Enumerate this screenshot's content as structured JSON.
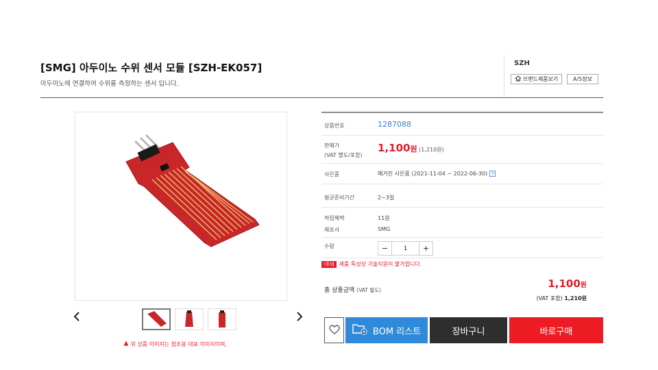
{
  "product": {
    "title": "[SMG] 아두이노 수위 센서 모듈 [SZH-EK057]",
    "subtitle": "아두이노에 연결하여 수위를 측정하는 센서 입니다."
  },
  "brand": {
    "name": "SZH",
    "brand_products_label": "브랜드제품보기",
    "as_info_label": "A/S정보"
  },
  "gallery": {
    "note": "위 상품 이미지는 참조용 대표 이미지이며,",
    "prev_icon": "chevron-left-icon",
    "next_icon": "chevron-right-icon"
  },
  "info": {
    "code_label": "상품번호",
    "code_value": "1287088",
    "price_label_1": "판매가",
    "price_label_2": "(VAT 별도/포함)",
    "price_value": "1,100",
    "price_unit": "원",
    "price_vat": "(1,210원)",
    "gift_label": "사은품",
    "gift_value": "메거진 사은품 (2021-11-04 ~ 2022-06-30)",
    "gift_help": "?",
    "lead_label": "평균준비기간",
    "lead_value": "2~3일",
    "points_label": "적립혜택",
    "points_value": "11원",
    "maker_label": "제조사",
    "maker_value": "SMG",
    "qty_label": "수량",
    "qty_minus": "−",
    "qty_value": "1",
    "qty_plus": "+",
    "warn_tag": "!주의",
    "warn_text": "제품 특성상 기술지원이 불가합니다."
  },
  "total": {
    "label": "총 상품금액",
    "label_note": "(VAT 별도)",
    "value": "1,100",
    "unit": "원",
    "vat_label": "(VAT 포함)",
    "vat_value": "1,210원"
  },
  "actions": {
    "bom_label": "BOM 리스트",
    "cart_label": "장바구니",
    "buy_label": "바로구매"
  },
  "colors": {
    "accent_red": "#e11d2a",
    "bom_blue": "#2f8bd9",
    "cart_dark": "#2e2e2e",
    "link_blue": "#3a7bd5"
  }
}
